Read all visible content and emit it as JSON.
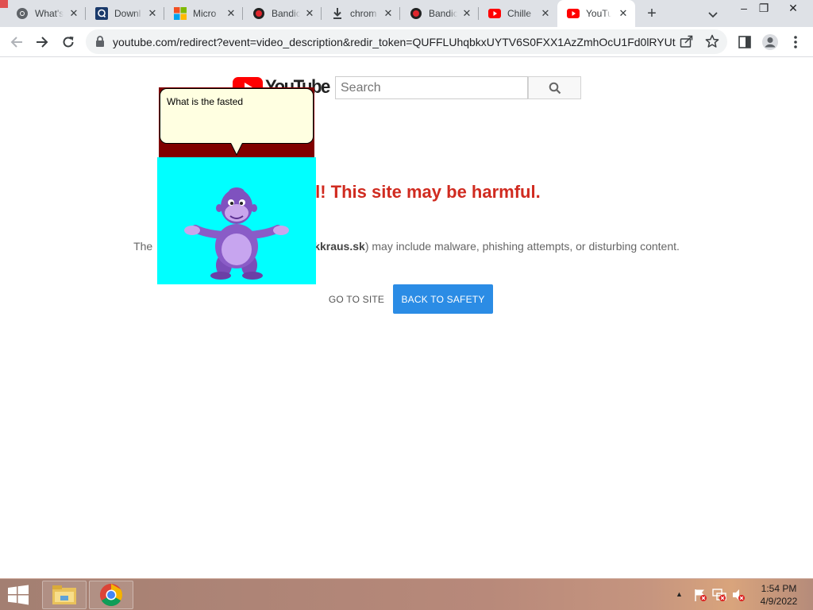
{
  "browser": {
    "tabs": [
      {
        "title": "What's",
        "icon": "chrome-icon"
      },
      {
        "title": "Downl",
        "icon": "q-app-icon"
      },
      {
        "title": "Micro",
        "icon": "microsoft-logo-icon"
      },
      {
        "title": "Bandic",
        "icon": "bandicam-icon"
      },
      {
        "title": "chrom",
        "icon": "download-icon"
      },
      {
        "title": "Bandic",
        "icon": "bandicam-icon"
      },
      {
        "title": "Chille",
        "icon": "youtube-icon"
      },
      {
        "title": "YouTu",
        "icon": "youtube-icon",
        "active": true
      }
    ],
    "new_tab_label": "+",
    "window_controls": {
      "minimize": "–",
      "restore": "❐",
      "close": "✕"
    }
  },
  "toolbar": {
    "url": "youtube.com/redirect?event=video_description&redir_token=QUFFLUhqbkxUYTV6S0FXX1AzZmhOcU1Fd0lRYUt..."
  },
  "page": {
    "logo_text": "YouTube",
    "search_placeholder": "Search",
    "warning_title": "areful! This site may be harmful.",
    "warning_body_prefix": "The",
    "warning_body_domain": "kkraus.sk",
    "warning_body_suffix": ") may include malware, phishing attempts, or disturbing content.",
    "go_to_site": "GO TO SITE",
    "back_to_safety": "BACK TO SAFETY"
  },
  "bonzi": {
    "speech": "What is the fasted"
  },
  "taskbar": {
    "time": "1:54 PM",
    "date": "4/9/2022"
  },
  "colors": {
    "warning_red": "#d02b20",
    "safety_blue": "#2b8ce5",
    "youtube_red": "#ff0000",
    "bonzi_purple": "#8a5cc7",
    "bonzi_bg": "#00ffff",
    "bonzi_backdrop": "#800000"
  }
}
